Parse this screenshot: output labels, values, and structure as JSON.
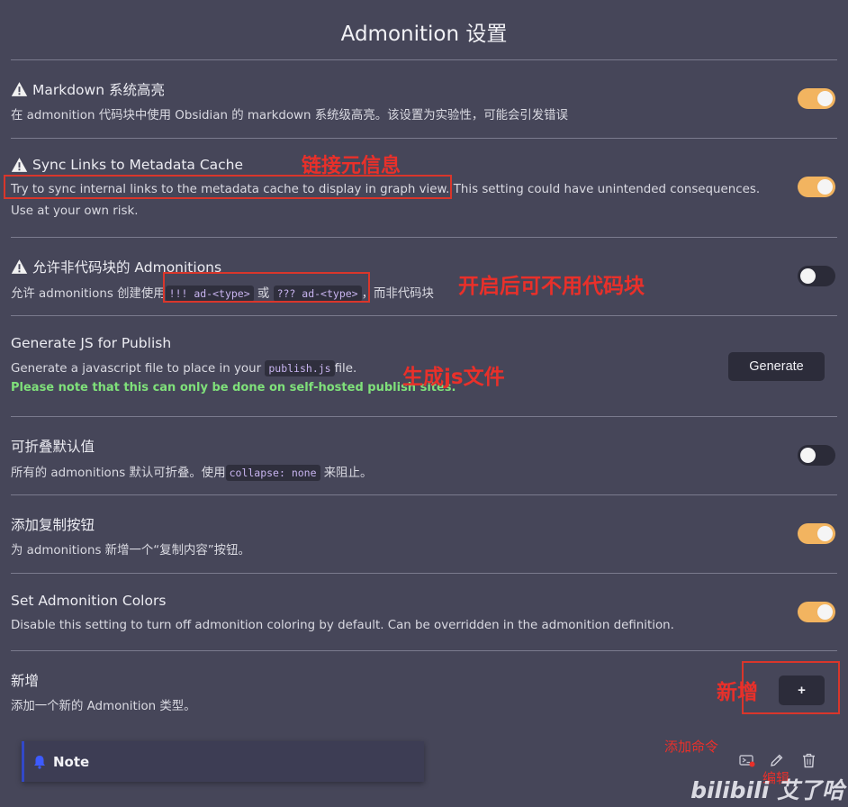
{
  "header": {
    "title": "Admonition 设置"
  },
  "settings": [
    {
      "name": "Markdown 系统高亮",
      "desc": "在 admonition 代码块中使用 Obsidian 的 markdown 系统级高亮。该设置为实验性，可能会引发错误",
      "toggle": "on"
    },
    {
      "name": "Sync Links to Metadata Cache",
      "desc_boxed": "Try to sync internal links to the metadata cache to display in graph view.",
      "desc_rest": " This setting could have unintended consequences.",
      "desc_line2": "Use at your own risk.",
      "toggle": "on"
    },
    {
      "name": "允许非代码块的 Admonitions",
      "desc_pre": "允许 admonitions 创建使用",
      "code1": "!!! ad-<type>",
      "desc_mid": "或",
      "code2": "??? ad-<type>",
      "desc_post": "，而非代码块",
      "toggle": "off"
    },
    {
      "name": "Generate JS for Publish",
      "desc_pre": "Generate a javascript file to place in your",
      "code": "publish.js",
      "desc_post": "file.",
      "note": "Please note that this can only be done on self-hosted publish sites.",
      "button": "Generate"
    },
    {
      "name": "可折叠默认值",
      "desc_pre": "所有的 admonitions 默认可折叠。使用",
      "code": "collapse: none",
      "desc_post": "来阻止。",
      "toggle": "off"
    },
    {
      "name": "添加复制按钮",
      "desc": "为 admonitions 新增一个“复制内容”按钮。",
      "toggle": "on"
    },
    {
      "name": "Set Admonition Colors",
      "desc": "Disable this setting to turn off admonition coloring by default. Can be overridden in the admonition definition.",
      "toggle": "on"
    },
    {
      "name": "新增",
      "desc": "添加一个新的 Admonition 类型。",
      "button": "+"
    }
  ],
  "admonition_item": {
    "title": "Note",
    "icon": "bell-icon",
    "accent": "#3248c8"
  },
  "annotations": {
    "sync_links": "链接元信息",
    "non_codeblock": "开启后可不用代码块",
    "generate_js": "生成js文件",
    "add_new": "新增",
    "add_command": "添加命令",
    "edit": "编辑"
  },
  "watermark": "bilibili 艾了哈",
  "colors": {
    "background": "#464659",
    "toggle_on": "#f2b460",
    "toggle_off": "#2b2b38",
    "annotation_red": "#e9302a",
    "note_green": "#7fe07a"
  }
}
